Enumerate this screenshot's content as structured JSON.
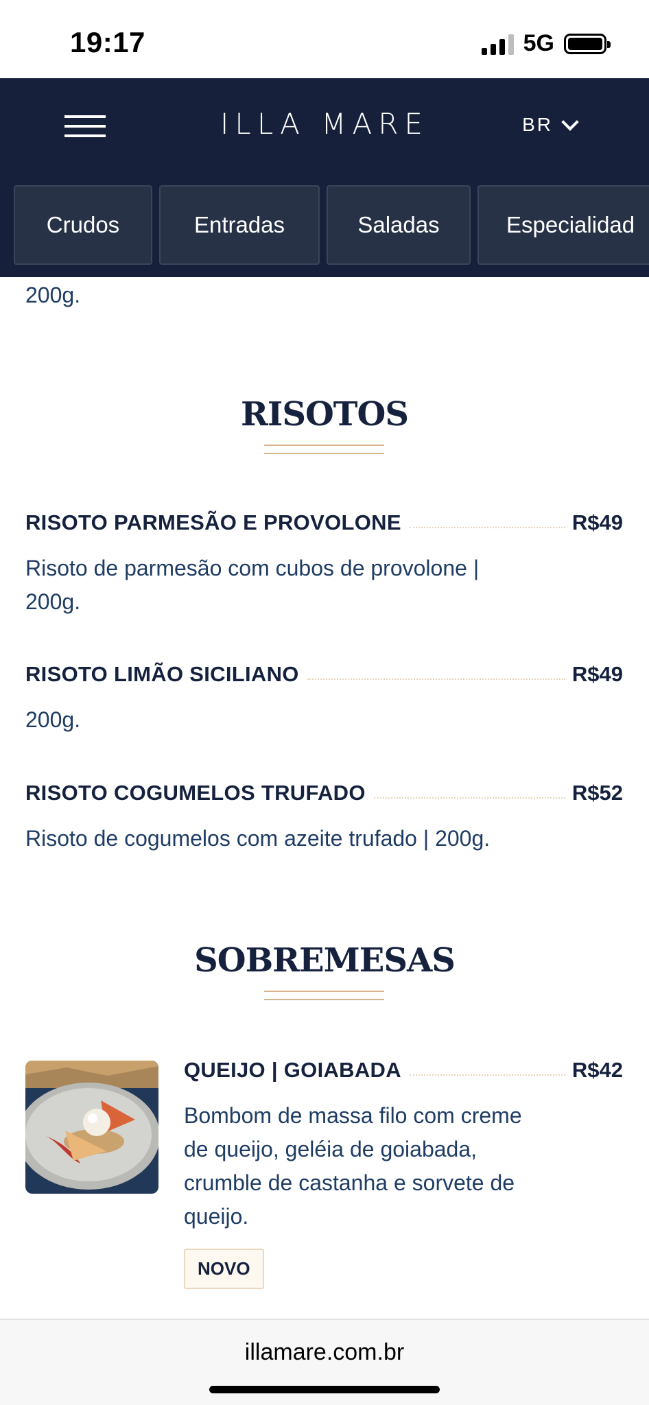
{
  "status_bar": {
    "time": "19:17",
    "network": "5G"
  },
  "header": {
    "brand": "ILLA MARE",
    "language": "BR",
    "tabs": [
      "Crudos",
      "Entradas",
      "Saladas",
      "Especialidad"
    ]
  },
  "content": {
    "partial_item_desc": "200g.",
    "sections": [
      {
        "title": "RISOTOS",
        "items": [
          {
            "name": "RISOTO PARMESÃO E PROVOLONE",
            "price": "R$49",
            "desc_line1": "Risoto de parmesão com cubos de provolone |",
            "desc_line2": "200g."
          },
          {
            "name": "RISOTO LIMÃO SICILIANO",
            "price": "R$49",
            "desc": "200g."
          },
          {
            "name": "RISOTO COGUMELOS TRUFADO",
            "price": "R$52",
            "desc": "Risoto de cogumelos com azeite trufado | 200g."
          }
        ]
      },
      {
        "title": "SOBREMESAS",
        "items": [
          {
            "name": "QUEIJO | GOIABADA",
            "price": "R$42",
            "desc_lines": [
              "Bombom de massa filo com creme",
              "de queijo, geléia de goiabada,",
              "crumble de castanha e sorvete de",
              "queijo."
            ],
            "badge": "NOVO"
          }
        ]
      }
    ]
  },
  "browser": {
    "url": "illamare.com.br"
  },
  "colors": {
    "header_bg": "#17203a",
    "tab_bg": "#283247",
    "accent_gold": "#d8b38a",
    "text_navy": "#15213d",
    "desc_blue": "#1f3d64"
  }
}
